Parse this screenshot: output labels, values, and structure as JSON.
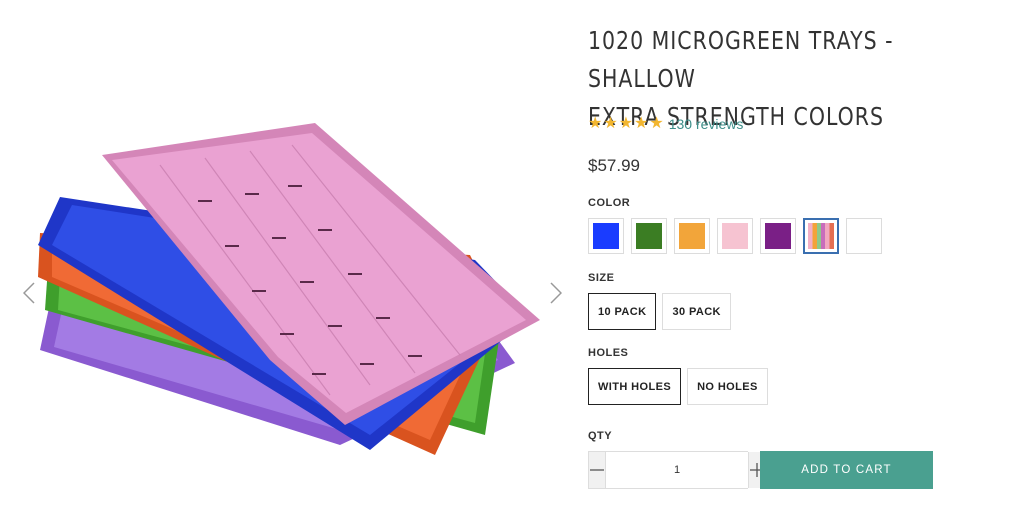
{
  "product": {
    "title_line1": "1020 MICROGREEN TRAYS - SHALLOW",
    "title_line2": "EXTRA STRENGTH COLORS",
    "rating": 5,
    "reviews_text": "130 reviews",
    "price": "$57.99",
    "image_alt": "Stack of colored microgreen trays",
    "tray_colors": [
      "#9b6bd8",
      "#4caf3a",
      "#e8602e",
      "#2440d0",
      "#e99ac9"
    ]
  },
  "options": {
    "color_label": "COLOR",
    "colors": [
      {
        "name": "Blue",
        "hex": "#1a3cff"
      },
      {
        "name": "Green",
        "hex": "#3b7d23"
      },
      {
        "name": "Orange",
        "hex": "#f2a53a"
      },
      {
        "name": "Pink",
        "hex": "#f6c3d1"
      },
      {
        "name": "Purple",
        "hex": "#7a1f86"
      },
      {
        "name": "Mixed",
        "hex": "mixed",
        "selected": true
      },
      {
        "name": "White",
        "hex": "#ffffff"
      }
    ],
    "size_label": "SIZE",
    "sizes": [
      {
        "label": "10 PACK",
        "selected": true
      },
      {
        "label": "30 PACK",
        "selected": false
      }
    ],
    "holes_label": "HOLES",
    "holes": [
      {
        "label": "WITH HOLES",
        "selected": true
      },
      {
        "label": "NO HOLES",
        "selected": false
      }
    ]
  },
  "quantity": {
    "label": "QTY",
    "value": "1"
  },
  "cart": {
    "add_label": "ADD TO CART",
    "accent": "#4aa090"
  },
  "icons": {
    "prev": "chevron-left-icon",
    "next": "chevron-right-icon",
    "star": "star-icon",
    "minus": "minus-icon",
    "plus": "plus-icon"
  }
}
